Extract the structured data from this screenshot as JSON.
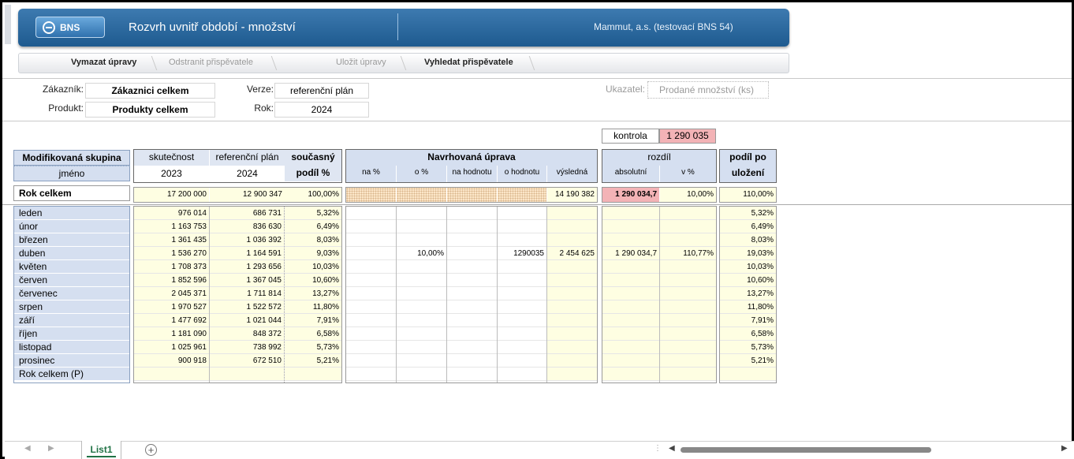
{
  "header": {
    "brand": "BNS",
    "title": "Rozvrh uvnitř období - množství",
    "company": "Mammut, a.s. (testovací BNS 54)"
  },
  "toolbar": {
    "clear": "Vymazat úpravy",
    "remove": "Odstranit přispěvatele",
    "save": "Uložit úpravy",
    "find": "Vyhledat přispěvatele"
  },
  "params": {
    "customer_label": "Zákazník:",
    "customer": "Zákaznici celkem",
    "product_label": "Produkt:",
    "product": "Produkty celkem",
    "version_label": "Verze:",
    "version": "referenční plán",
    "year_label": "Rok:",
    "year": "2024",
    "indicator_label": "Ukazatel:",
    "indicator": "Prodané množství (ks)"
  },
  "check": {
    "label": "kontrola",
    "value": "1 290 035"
  },
  "table": {
    "h_group": "Modifikovaná skupina",
    "h_name": "jméno",
    "h_actual": "skutečnost",
    "h_actual_year": "2023",
    "h_ref": "referenční plán",
    "h_ref_year": "2024",
    "h_share1": "současný",
    "h_share2": "podíl %",
    "h_prop": "Navrhovaná úprava",
    "h_na_pct": "na %",
    "h_o_pct": "o %",
    "h_na_val": "na hodnotu",
    "h_o_val": "o hodnotu",
    "h_result": "výsledná",
    "h_diff": "rozdíl",
    "h_abs": "absolutní",
    "h_vpct": "v %",
    "h_after1": "podíl po",
    "h_after2": "uložení",
    "total": {
      "name": "Rok celkem",
      "actual": "17 200 000",
      "ref": "12 900 347",
      "share": "100,00%",
      "result": "14 190 382",
      "abs": "1 290 034,7",
      "vpct": "10,00%",
      "after": "110,00%"
    },
    "rows": [
      {
        "name": "leden",
        "actual": "976 014",
        "ref": "686 731",
        "share": "5,32%",
        "o_pct": "",
        "o_val": "",
        "result": "",
        "abs": "",
        "vpct": "",
        "after": "5,32%"
      },
      {
        "name": "únor",
        "actual": "1 163 753",
        "ref": "836 630",
        "share": "6,49%",
        "o_pct": "",
        "o_val": "",
        "result": "",
        "abs": "",
        "vpct": "",
        "after": "6,49%"
      },
      {
        "name": "březen",
        "actual": "1 361 435",
        "ref": "1 036 392",
        "share": "8,03%",
        "o_pct": "",
        "o_val": "",
        "result": "",
        "abs": "",
        "vpct": "",
        "after": "8,03%"
      },
      {
        "name": "duben",
        "actual": "1 536 270",
        "ref": "1 164 591",
        "share": "9,03%",
        "o_pct": "10,00%",
        "o_val": "1290035",
        "result": "2 454 625",
        "abs": "1 290 034,7",
        "vpct": "110,77%",
        "after": "19,03%"
      },
      {
        "name": "květen",
        "actual": "1 708 373",
        "ref": "1 293 656",
        "share": "10,03%",
        "o_pct": "",
        "o_val": "",
        "result": "",
        "abs": "",
        "vpct": "",
        "after": "10,03%"
      },
      {
        "name": "červen",
        "actual": "1 852 596",
        "ref": "1 367 045",
        "share": "10,60%",
        "o_pct": "",
        "o_val": "",
        "result": "",
        "abs": "",
        "vpct": "",
        "after": "10,60%"
      },
      {
        "name": "červenec",
        "actual": "2 045 371",
        "ref": "1 711 814",
        "share": "13,27%",
        "o_pct": "",
        "o_val": "",
        "result": "",
        "abs": "",
        "vpct": "",
        "after": "13,27%"
      },
      {
        "name": "srpen",
        "actual": "1 970 527",
        "ref": "1 522 572",
        "share": "11,80%",
        "o_pct": "",
        "o_val": "",
        "result": "",
        "abs": "",
        "vpct": "",
        "after": "11,80%"
      },
      {
        "name": "září",
        "actual": "1 477 692",
        "ref": "1 021 044",
        "share": "7,91%",
        "o_pct": "",
        "o_val": "",
        "result": "",
        "abs": "",
        "vpct": "",
        "after": "7,91%"
      },
      {
        "name": "říjen",
        "actual": "1 181 090",
        "ref": "848 372",
        "share": "6,58%",
        "o_pct": "",
        "o_val": "",
        "result": "",
        "abs": "",
        "vpct": "",
        "after": "6,58%"
      },
      {
        "name": "listopad",
        "actual": "1 025 961",
        "ref": "738 992",
        "share": "5,73%",
        "o_pct": "",
        "o_val": "",
        "result": "",
        "abs": "",
        "vpct": "",
        "after": "5,73%"
      },
      {
        "name": "prosinec",
        "actual": "900 918",
        "ref": "672 510",
        "share": "5,21%",
        "o_pct": "",
        "o_val": "",
        "result": "",
        "abs": "",
        "vpct": "",
        "after": "5,21%"
      },
      {
        "name": "Rok celkem (P)",
        "actual": "",
        "ref": "",
        "share": "",
        "o_pct": "",
        "o_val": "",
        "result": "",
        "abs": "",
        "vpct": "",
        "after": ""
      }
    ]
  },
  "sheet_tab": "List1"
}
